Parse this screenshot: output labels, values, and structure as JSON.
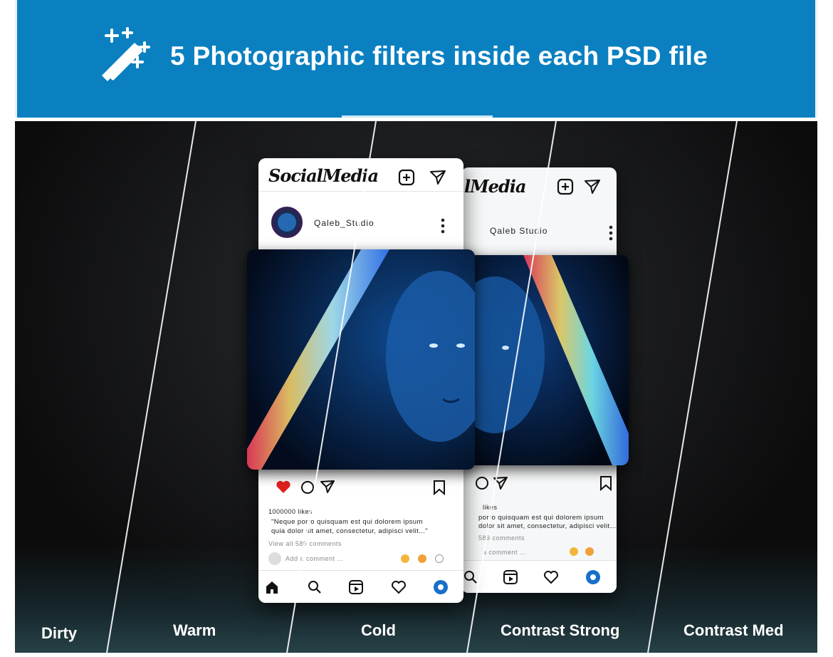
{
  "banner": {
    "title": "5 Photographic filters inside each PSD file",
    "icon": "magic-wand-icon",
    "background_color": "#0b80c1"
  },
  "filters": [
    "Dirty",
    "Warm",
    "Cold",
    "Contrast Strong",
    "Contrast Med"
  ],
  "post_front": {
    "app_logo": "SocialMedia",
    "username": "Qaleb_Studio",
    "likes": "1000000 likes",
    "caption_line1": "\"Neque porro quisquam est qui dolorem ipsum",
    "caption_line2": "quia dolor sit amet, consectetur, adipisci velit...\"",
    "view_comments": "View all 589 comments",
    "add_comment_placeholder": "Add a comment ..."
  },
  "post_back": {
    "app_logo": "lMedia",
    "username": "Qaleb Studio",
    "likes": "likes",
    "caption_line1": "porro quisquam est qui dolorem ipsum",
    "caption_line2": "dolor sit amet, consectetur, adipisci velit...\"",
    "view_comments": "589 comments",
    "add_comment_placeholder": "a comment ..."
  }
}
